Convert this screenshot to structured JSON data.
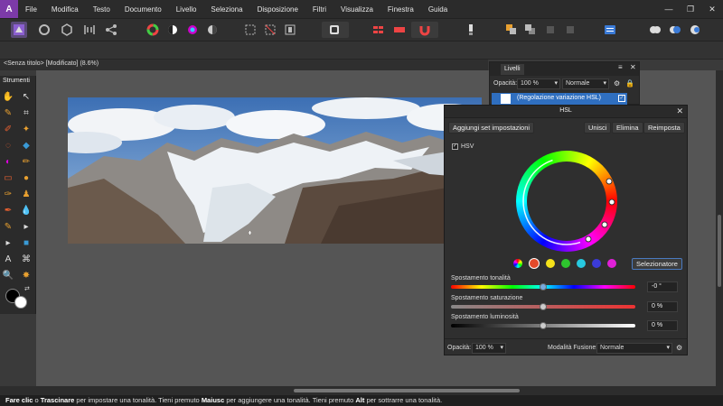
{
  "menubar": {
    "logo": "A",
    "items": [
      "File",
      "Modifica",
      "Testo",
      "Documento",
      "Livello",
      "Seleziona",
      "Disposizione",
      "Filtri",
      "Visualizza",
      "Finestra",
      "Guida"
    ],
    "window_controls": [
      "—",
      "❐",
      "✕"
    ]
  },
  "document_tab": {
    "title": "<Senza titolo> [Modificato] (8.6%)"
  },
  "tools_panel": {
    "title": "Strumenti"
  },
  "layers_panel": {
    "tab": "Livelli",
    "opacity_label": "Opacità:",
    "opacity_value": "100 %",
    "blend_mode": "Normale",
    "layer_name": "(Regolazione variazione HSL)"
  },
  "hsl_dialog": {
    "title": "HSL",
    "add_preset": "Aggiungi set impostazioni",
    "merge": "Unisci",
    "delete": "Elimina",
    "reset": "Reimposta",
    "hsv_label": "HSV",
    "hsv_checked": true,
    "selector_button": "Selezionatore",
    "color_swatches": [
      "#e34a2a",
      "#f5e21a",
      "#2ec62e",
      "#27c9e0",
      "#3b3bd8",
      "#e020d8"
    ],
    "hue_label": "Spostamento tonalità",
    "hue_value": "-0 °",
    "saturation_label": "Spostamento saturazione",
    "saturation_value": "0 %",
    "luminosity_label": "Spostamento luminosità",
    "luminosity_value": "0 %",
    "opacity_label": "Opacità:",
    "opacity_value": "100 %",
    "blend_label": "Modalità Fusione:",
    "blend_value": "Normale"
  },
  "status_bar": {
    "part1": "Fare clic",
    "part2": " o ",
    "part3": "Trascinare",
    "part4": " per impostare una tonalità. Tieni premuto ",
    "part5": "Maiusc",
    "part6": " per aggiungere una tonalità. Tieni premuto ",
    "part7": "Alt",
    "part8": " per sottrarre una tonalità."
  }
}
